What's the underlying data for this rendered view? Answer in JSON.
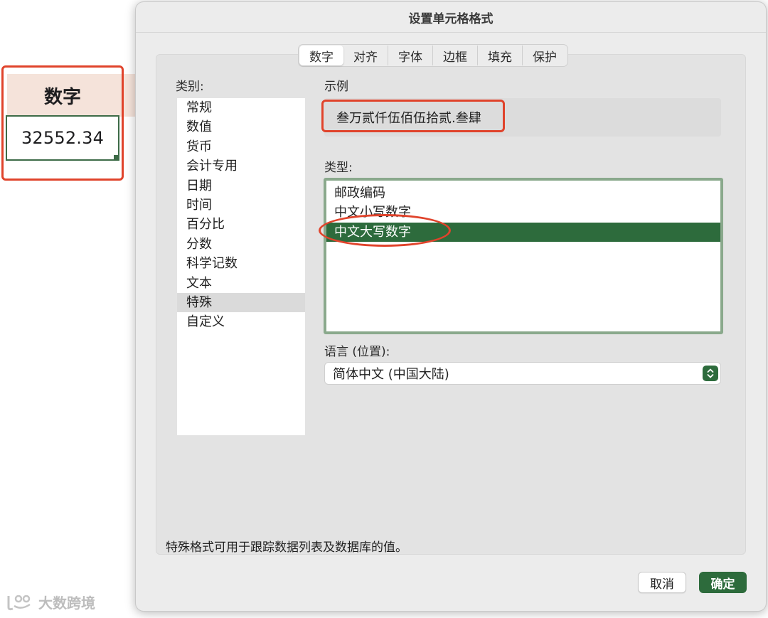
{
  "sheet": {
    "header_cell": "数字",
    "value_cell": "32552.34"
  },
  "watermark": {
    "text": "大数跨境"
  },
  "dialog": {
    "title": "设置单元格格式",
    "tabs": [
      {
        "label": "数字",
        "active": true
      },
      {
        "label": "对齐"
      },
      {
        "label": "字体"
      },
      {
        "label": "边框"
      },
      {
        "label": "填充"
      },
      {
        "label": "保护"
      }
    ],
    "category_label": "类别:",
    "categories": [
      "常规",
      "数值",
      "货币",
      "会计专用",
      "日期",
      "时间",
      "百分比",
      "分数",
      "科学记数",
      "文本",
      "特殊",
      "自定义"
    ],
    "selected_category": "特殊",
    "sample_label": "示例",
    "sample_value": "叁万贰仟伍佰伍拾贰.叁肆",
    "type_label": "类型:",
    "types": [
      "邮政编码",
      "中文小写数字",
      "中文大写数字"
    ],
    "selected_type": "中文大写数字",
    "locale_label": "语言 (位置):",
    "locale_value": "简体中文 (中国大陆)",
    "description": "特殊格式可用于跟踪数据列表及数据库的值。",
    "cancel_label": "取消",
    "ok_label": "确定"
  },
  "colors": {
    "accent_green": "#2d6b3c",
    "annotation_red": "#e0432b",
    "header_fill": "#f5e3da"
  }
}
